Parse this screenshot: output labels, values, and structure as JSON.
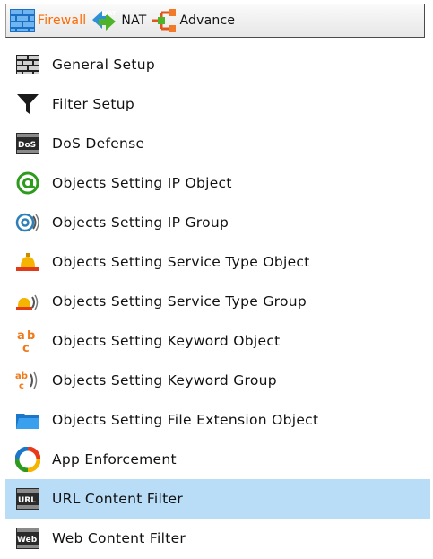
{
  "topbar": {
    "tabs": [
      {
        "label": "Firewall",
        "icon": "brick-wall-icon",
        "color": "#ff6a00"
      },
      {
        "label": "NAT",
        "icon": "nat-arrows-icon"
      },
      {
        "label": "Advance",
        "icon": "network-branch-icon"
      }
    ]
  },
  "menu": {
    "items": [
      {
        "label": "General Setup",
        "icon": "brick-wall-icon"
      },
      {
        "label": "Filter Setup",
        "icon": "funnel-icon"
      },
      {
        "label": "DoS Defense",
        "icon": "dos-icon"
      },
      {
        "label": "Objects Setting IP Object",
        "icon": "at-sign-icon"
      },
      {
        "label": "Objects Setting IP Group",
        "icon": "at-sign-group-icon"
      },
      {
        "label": "Objects Setting Service Type Object",
        "icon": "bell-icon"
      },
      {
        "label": "Objects Setting Service Type Group",
        "icon": "bell-group-icon"
      },
      {
        "label": "Objects Setting Keyword Object",
        "icon": "abc-icon"
      },
      {
        "label": "Objects Setting Keyword Group",
        "icon": "abc-group-icon"
      },
      {
        "label": "Objects Setting File Extension Object",
        "icon": "folder-icon"
      },
      {
        "label": "App Enforcement",
        "icon": "app-ring-icon"
      },
      {
        "label": "URL Content Filter",
        "icon": "url-badge-icon",
        "selected": true
      },
      {
        "label": "Web Content Filter",
        "icon": "web-badge-icon"
      }
    ],
    "selected_color": "#b9dcf7"
  }
}
